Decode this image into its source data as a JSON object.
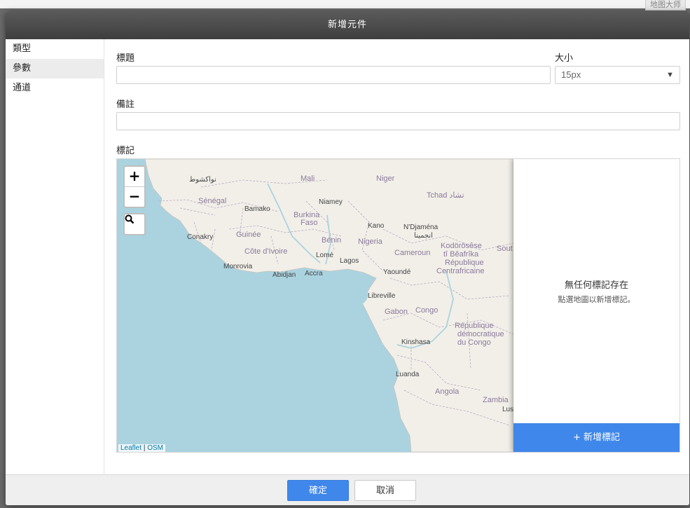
{
  "background": {
    "corner_text": "地图大师"
  },
  "dialog": {
    "title": "新增元件",
    "sidebar": [
      {
        "label": "類型",
        "active": false
      },
      {
        "label": "參數",
        "active": true
      },
      {
        "label": "通道",
        "active": false
      }
    ],
    "form": {
      "title_label": "標題",
      "title_value": "",
      "size_label": "大小",
      "size_value": "15px",
      "note_label": "備註",
      "note_value": "",
      "marker_label": "標記"
    },
    "map": {
      "zoom_in": "+",
      "zoom_out": "−",
      "attribution_leaflet": "Leaflet",
      "attribution_sep": "|",
      "attribution_osm": "OSM",
      "labels": {
        "nouakchott": "نواكشوط",
        "mali": "Mali",
        "niger": "Niger",
        "tchad": "Tchad تشاد",
        "senegal": "Sénégal",
        "bamako": "Bamako",
        "niamey": "Niamey",
        "burkina": "Burkina",
        "faso": "Faso",
        "kano": "Kano",
        "ndjamena": "N'Djaména",
        "ndjamena_ar": "انجمينا",
        "conakry": "Conakry",
        "guinee": "Guinée",
        "benin": "Bénin",
        "nigeria": "Nigeria",
        "kodorosese": "Kodörösêse",
        "sout": "Sout",
        "cote": "Côte d'Ivoire",
        "lome": "Lomé",
        "lagos": "Lagos",
        "cameroun": "Cameroun",
        "ti_beafrika": "tî Bêafrîka",
        "rep": "République",
        "monrovia": "Monrovia",
        "accra": "Accra",
        "abidjan": "Abidjan",
        "yaounde": "Yaoundé",
        "centrafricaine": "Centrafricaine",
        "libreville": "Libreville",
        "gabon": "Gabon",
        "congo": "Congo",
        "rep_dem": "République",
        "democratique": "démocratique",
        "kinshasa": "Kinshasa",
        "du_congo": "du Congo",
        "luanda": "Luanda",
        "angola": "Angola",
        "zambia": "Zambia",
        "lus": "Lus"
      }
    },
    "marker_panel": {
      "empty_title": "無任何標記存在",
      "empty_hint": "點選地圖以新增標記。",
      "add_button": "+ 新增標記"
    },
    "footer": {
      "confirm": "確定",
      "cancel": "取消"
    }
  },
  "colors": {
    "accent": "#3f87ea",
    "water": "#aad3df",
    "land": "#f2efe9"
  }
}
